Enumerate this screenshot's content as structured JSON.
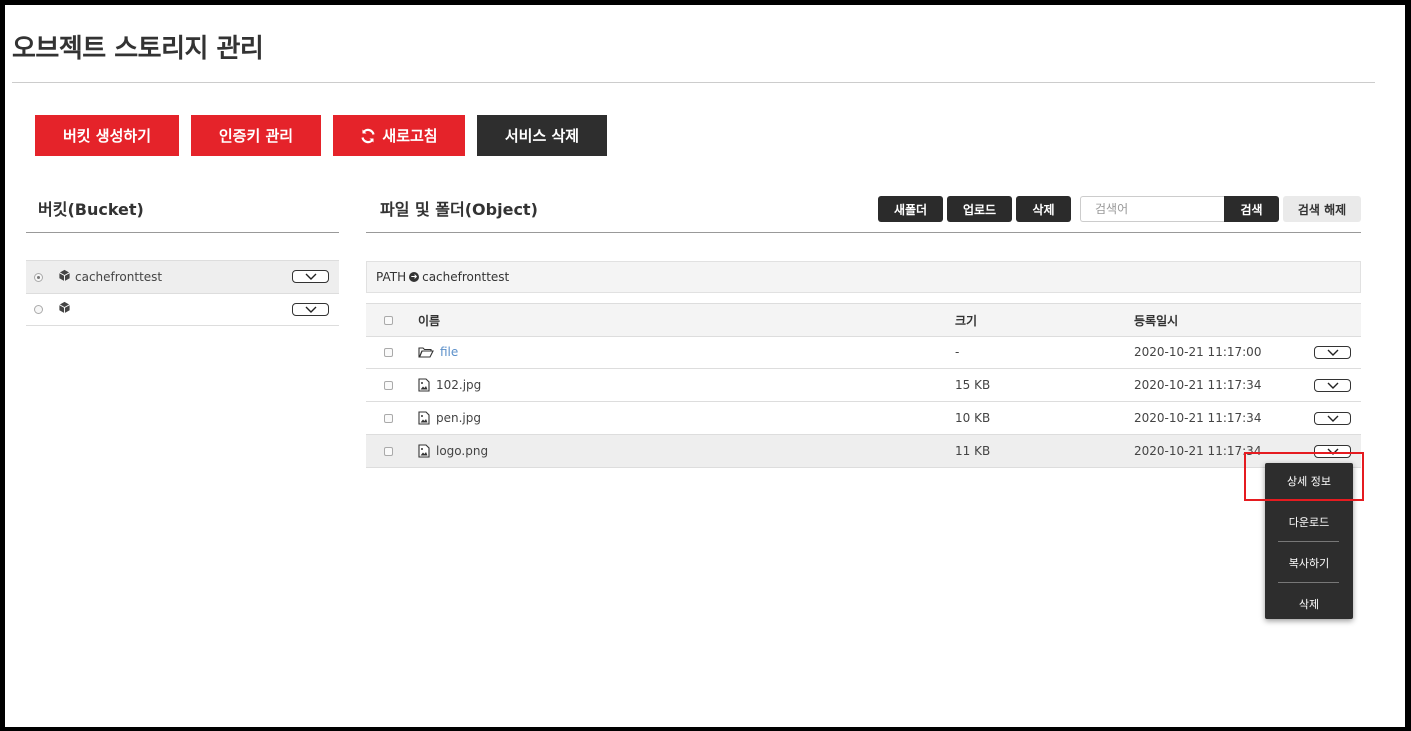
{
  "page": {
    "title": "오브젝트 스토리지 관리"
  },
  "actions": {
    "create_bucket": "버킷 생성하기",
    "key_manage": "인증키 관리",
    "refresh": "새로고침",
    "delete_service": "서비스 삭제"
  },
  "buckets": {
    "title": "버킷(Bucket)",
    "items": [
      {
        "name": "cachefronttest",
        "selected": true
      },
      {
        "name": "",
        "selected": false
      }
    ]
  },
  "objects": {
    "title": "파일 및 폴더(Object)",
    "toolbar": {
      "new_folder": "새폴더",
      "upload": "업로드",
      "delete": "삭제",
      "search_placeholder": "검색어",
      "search": "검색",
      "clear_search": "검색 해제"
    },
    "path_label": "PATH",
    "path_value": "cachefronttest",
    "columns": {
      "name": "이름",
      "size": "크기",
      "date": "등록일시"
    },
    "rows": [
      {
        "type": "folder",
        "name": "file",
        "size": "-",
        "date": "2020-10-21 11:17:00"
      },
      {
        "type": "image",
        "name": "102.jpg",
        "size": "15 KB",
        "date": "2020-10-21 11:17:34"
      },
      {
        "type": "image",
        "name": "pen.jpg",
        "size": "10 KB",
        "date": "2020-10-21 11:17:34"
      },
      {
        "type": "image",
        "name": "logo.png",
        "size": "11 KB",
        "date": "2020-10-21 11:17:34"
      }
    ]
  },
  "context_menu": {
    "items": [
      "상세 정보",
      "다운로드",
      "복사하기",
      "삭제"
    ]
  },
  "colors": {
    "accent": "#e5232a",
    "dark": "#2e2e2e",
    "link": "#5b8fc9"
  },
  "icons": [
    "refresh-icon",
    "cube-icon",
    "chevron-down-icon",
    "folder-open-icon",
    "image-file-icon",
    "arrow-circle-right-icon"
  ]
}
